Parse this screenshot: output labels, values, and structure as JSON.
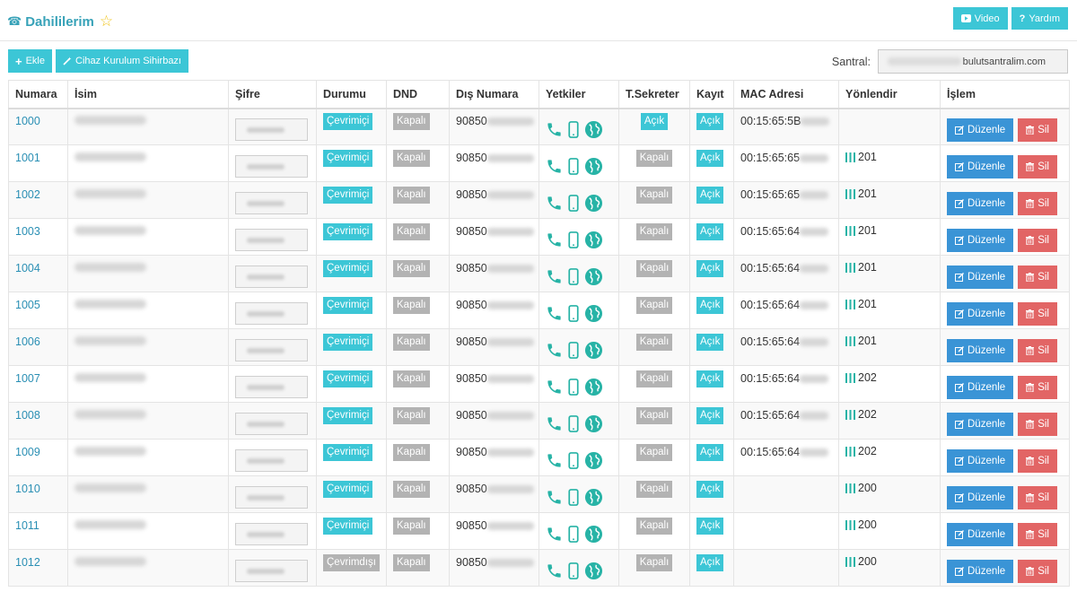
{
  "header": {
    "title": "Dahililerim",
    "video_label": "Video",
    "help_label": "Yardım"
  },
  "toolbar": {
    "add_label": "Ekle",
    "wizard_label": "Cihaz Kurulum Sihirbazı",
    "santral_label": "Santral:",
    "santral_value": "bulutsantralim.com"
  },
  "table": {
    "columns": [
      "Numara",
      "İsim",
      "Şifre",
      "Durumu",
      "DND",
      "Dış Numara",
      "Yetkiler",
      "T.Sekreter",
      "Kayıt",
      "MAC Adresi",
      "Yönlendir",
      "İşlem"
    ],
    "edit_label": "Düzenle",
    "delete_label": "Sil",
    "rows": [
      {
        "numara": "1000",
        "durum": "Çevrimiçi",
        "durum_type": "online",
        "dnd": "Kapalı",
        "dis": "90850",
        "tsek": "Açık",
        "tsek_on": true,
        "kayit": "Açık",
        "mac": "00:15:65:5B",
        "yon": ""
      },
      {
        "numara": "1001",
        "durum": "Çevrimiçi",
        "durum_type": "online",
        "dnd": "Kapalı",
        "dis": "90850",
        "tsek": "Kapalı",
        "tsek_on": false,
        "kayit": "Açık",
        "mac": "00:15:65:65",
        "yon": "201"
      },
      {
        "numara": "1002",
        "durum": "Çevrimiçi",
        "durum_type": "online",
        "dnd": "Kapalı",
        "dis": "90850",
        "tsek": "Kapalı",
        "tsek_on": false,
        "kayit": "Açık",
        "mac": "00:15:65:65",
        "yon": "201"
      },
      {
        "numara": "1003",
        "durum": "Çevrimiçi",
        "durum_type": "online",
        "dnd": "Kapalı",
        "dis": "90850",
        "tsek": "Kapalı",
        "tsek_on": false,
        "kayit": "Açık",
        "mac": "00:15:65:64",
        "yon": "201"
      },
      {
        "numara": "1004",
        "durum": "Çevrimiçi",
        "durum_type": "online",
        "dnd": "Kapalı",
        "dis": "90850",
        "tsek": "Kapalı",
        "tsek_on": false,
        "kayit": "Açık",
        "mac": "00:15:65:64",
        "yon": "201"
      },
      {
        "numara": "1005",
        "durum": "Çevrimiçi",
        "durum_type": "online",
        "dnd": "Kapalı",
        "dis": "90850",
        "tsek": "Kapalı",
        "tsek_on": false,
        "kayit": "Açık",
        "mac": "00:15:65:64",
        "yon": "201"
      },
      {
        "numara": "1006",
        "durum": "Çevrimiçi",
        "durum_type": "online",
        "dnd": "Kapalı",
        "dis": "90850",
        "tsek": "Kapalı",
        "tsek_on": false,
        "kayit": "Açık",
        "mac": "00:15:65:64",
        "yon": "201"
      },
      {
        "numara": "1007",
        "durum": "Çevrimiçi",
        "durum_type": "online",
        "dnd": "Kapalı",
        "dis": "90850",
        "tsek": "Kapalı",
        "tsek_on": false,
        "kayit": "Açık",
        "mac": "00:15:65:64",
        "yon": "202"
      },
      {
        "numara": "1008",
        "durum": "Çevrimiçi",
        "durum_type": "online",
        "dnd": "Kapalı",
        "dis": "90850",
        "tsek": "Kapalı",
        "tsek_on": false,
        "kayit": "Açık",
        "mac": "00:15:65:64",
        "yon": "202"
      },
      {
        "numara": "1009",
        "durum": "Çevrimiçi",
        "durum_type": "online",
        "dnd": "Kapalı",
        "dis": "90850",
        "tsek": "Kapalı",
        "tsek_on": false,
        "kayit": "Açık",
        "mac": "00:15:65:64",
        "yon": "202"
      },
      {
        "numara": "1010",
        "durum": "Çevrimiçi",
        "durum_type": "online",
        "dnd": "Kapalı",
        "dis": "90850",
        "tsek": "Kapalı",
        "tsek_on": false,
        "kayit": "Açık",
        "mac": "",
        "yon": "200"
      },
      {
        "numara": "1011",
        "durum": "Çevrimiçi",
        "durum_type": "online",
        "dnd": "Kapalı",
        "dis": "90850",
        "tsek": "Kapalı",
        "tsek_on": false,
        "kayit": "Açık",
        "mac": "",
        "yon": "200"
      },
      {
        "numara": "1012",
        "durum": "Çevrimdışı",
        "durum_type": "offline",
        "dnd": "Kapalı",
        "dis": "90850",
        "tsek": "Kapalı",
        "tsek_on": false,
        "kayit": "Açık",
        "mac": "",
        "yon": "200"
      }
    ]
  },
  "colors": {
    "accent_cyan": "#3cc6d6",
    "title_teal": "#37a2b8",
    "edit_blue": "#3a94d6",
    "delete_red": "#e26565",
    "badge_gray": "#b3b3b3",
    "icon_teal": "#27b3a6"
  },
  "icons": {
    "title": "phone-icon",
    "favorite": "star-icon",
    "video": "video-icon",
    "help": "question-icon",
    "add": "plus-icon",
    "wizard": "wand-icon",
    "perm_call": "phone-icon",
    "perm_mobile": "mobile-icon",
    "perm_web": "globe-icon",
    "edit": "edit-icon",
    "delete": "trash-icon",
    "forward": "bars-icon"
  }
}
